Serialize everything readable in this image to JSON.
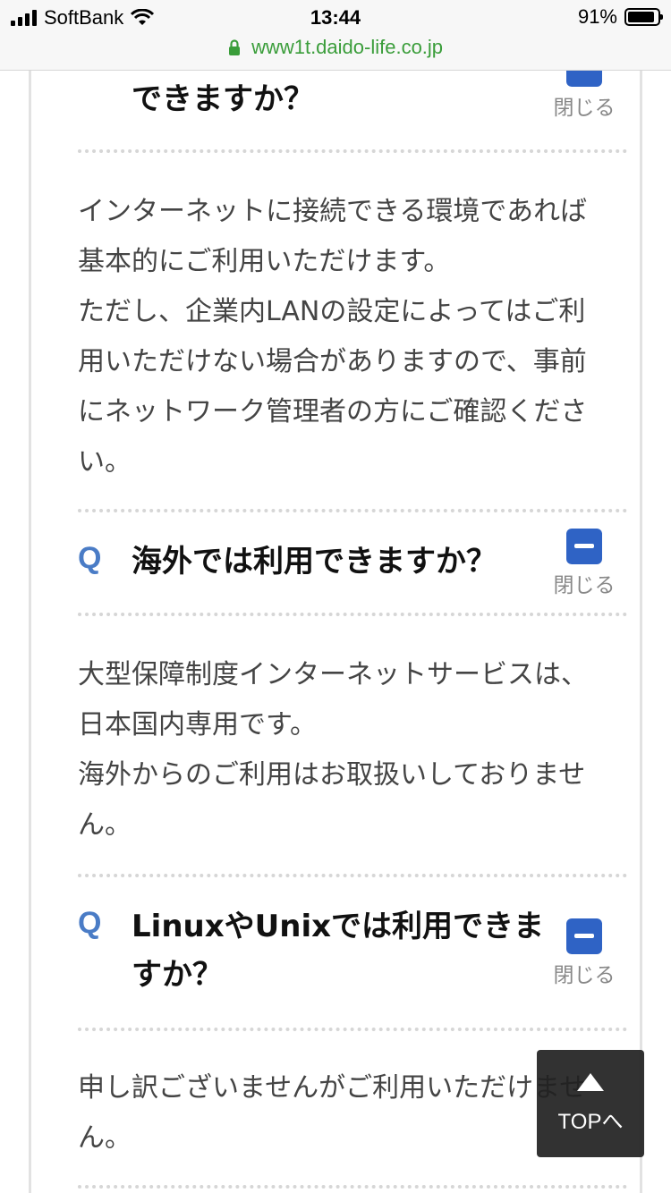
{
  "status": {
    "carrier": "SoftBank",
    "time": "13:44",
    "battery_percent": "91%",
    "battery_level": 0.91
  },
  "browser": {
    "url": "www1t.daido-life.co.jp"
  },
  "faq": [
    {
      "question_tail": "できますか？",
      "toggle_label": "閉じる",
      "answer": [
        "インターネットに接続できる環境であれば基本的にご利用いただけます。",
        "ただし、企業内LANの設定によってはご利用いただけない場合がありますので、事前にネットワーク管理者の方にご確認ください。"
      ]
    },
    {
      "q_mark": "Q",
      "question": "海外では利用できますか？",
      "toggle_label": "閉じる",
      "answer": [
        "大型保障制度インターネットサービスは、日本国内専用です。",
        "海外からのご利用はお取扱いしておりません。"
      ]
    },
    {
      "q_mark": "Q",
      "question": "LinuxやUnixでは利用できますか？",
      "toggle_label": "閉じる",
      "answer": [
        "申し訳ございませんがご利用いただけません。"
      ]
    }
  ],
  "top_button": {
    "label": "TOPへ"
  }
}
